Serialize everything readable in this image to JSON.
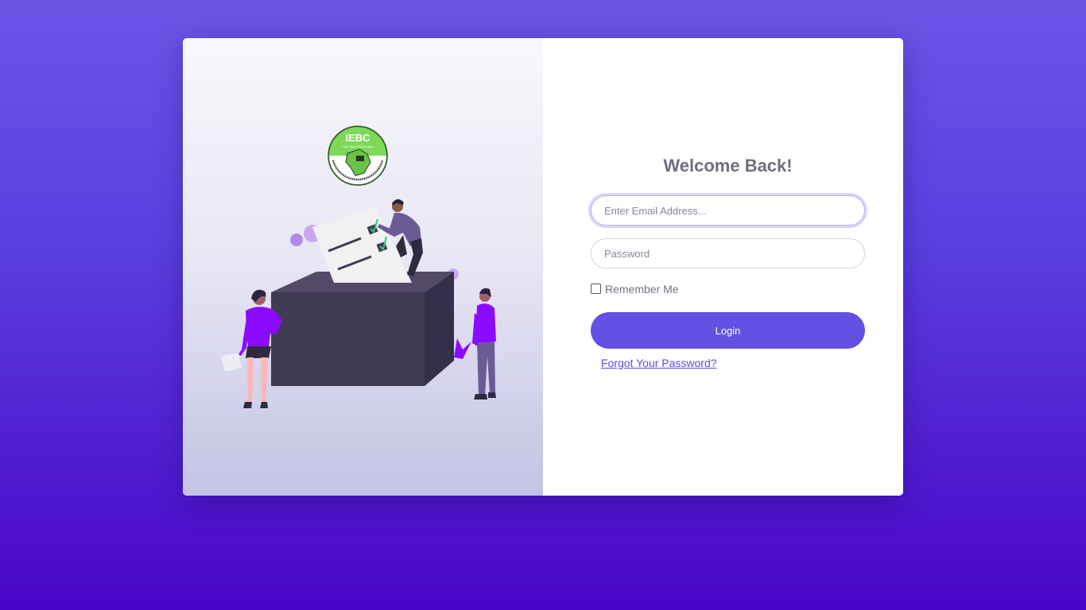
{
  "logo": {
    "text": "IEBC",
    "tagline": "Your Vote Your Future",
    "ring_text": "INDEPENDENT ELECTORAL AND BOUNDARIES COMMISSION"
  },
  "login": {
    "title": "Welcome Back!",
    "email_placeholder": "Enter Email Address...",
    "email_value": "",
    "password_placeholder": "Password",
    "password_value": "",
    "remember_label": "Remember Me",
    "remember_checked": false,
    "login_label": "Login",
    "forgot_label": "Forgot Your Password?"
  },
  "colors": {
    "accent": "#6450e2",
    "background_top": "#6b55e6",
    "background_bottom": "#4a05c8",
    "illustration_purple": "#8a0bff",
    "ballot_box": "#403a52",
    "logo_green": "#7ed957"
  }
}
